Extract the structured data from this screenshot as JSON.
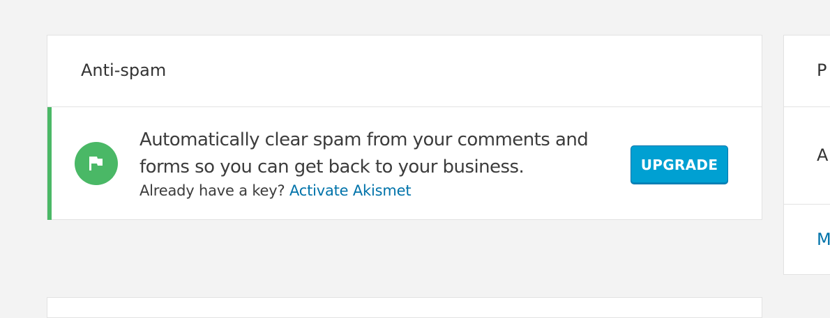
{
  "card": {
    "title": "Anti-spam",
    "headline": "Automatically clear spam from your comments and forms so you can get back to your business.",
    "subline_prefix": "Already have a key?",
    "activate_link": "Activate Akismet",
    "upgrade_label": "UPGRADE",
    "icon": "flag-icon",
    "accent_color": "#4ab866"
  },
  "side_card": {
    "row1_text": "P",
    "row2_text": "A",
    "row3_text": "M"
  },
  "colors": {
    "button": "#00a0d2",
    "link": "#0073aa",
    "background": "#f3f3f3"
  }
}
